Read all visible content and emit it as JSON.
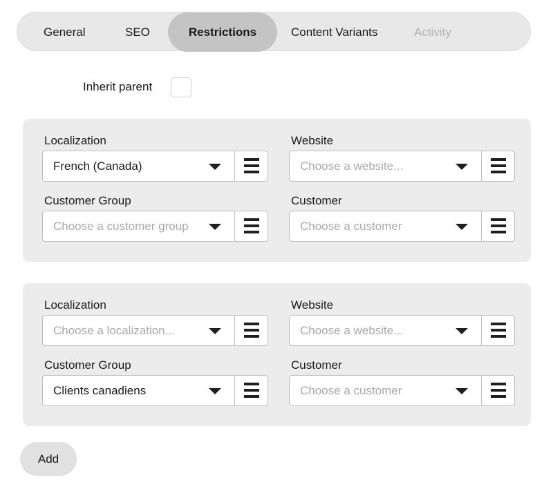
{
  "tabs": [
    {
      "label": "General"
    },
    {
      "label": "SEO"
    },
    {
      "label": "Restrictions"
    },
    {
      "label": "Content Variants"
    },
    {
      "label": "Activity"
    }
  ],
  "inherit": {
    "label": "Inherit parent",
    "checked": false
  },
  "restrictions": [
    {
      "localization": {
        "label": "Localization",
        "value": "French (Canada)",
        "placeholder": "Choose a localization..."
      },
      "website": {
        "label": "Website",
        "value": "",
        "placeholder": "Choose a website..."
      },
      "customer_group": {
        "label": "Customer Group",
        "value": "",
        "placeholder": "Choose a customer group"
      },
      "customer": {
        "label": "Customer",
        "value": "",
        "placeholder": "Choose a customer"
      }
    },
    {
      "localization": {
        "label": "Localization",
        "value": "",
        "placeholder": "Choose a localization..."
      },
      "website": {
        "label": "Website",
        "value": "",
        "placeholder": "Choose a website..."
      },
      "customer_group": {
        "label": "Customer Group",
        "value": "Clients canadiens",
        "placeholder": "Choose a customer group"
      },
      "customer": {
        "label": "Customer",
        "value": "",
        "placeholder": "Choose a customer"
      }
    }
  ],
  "actions": {
    "add_label": "Add"
  }
}
